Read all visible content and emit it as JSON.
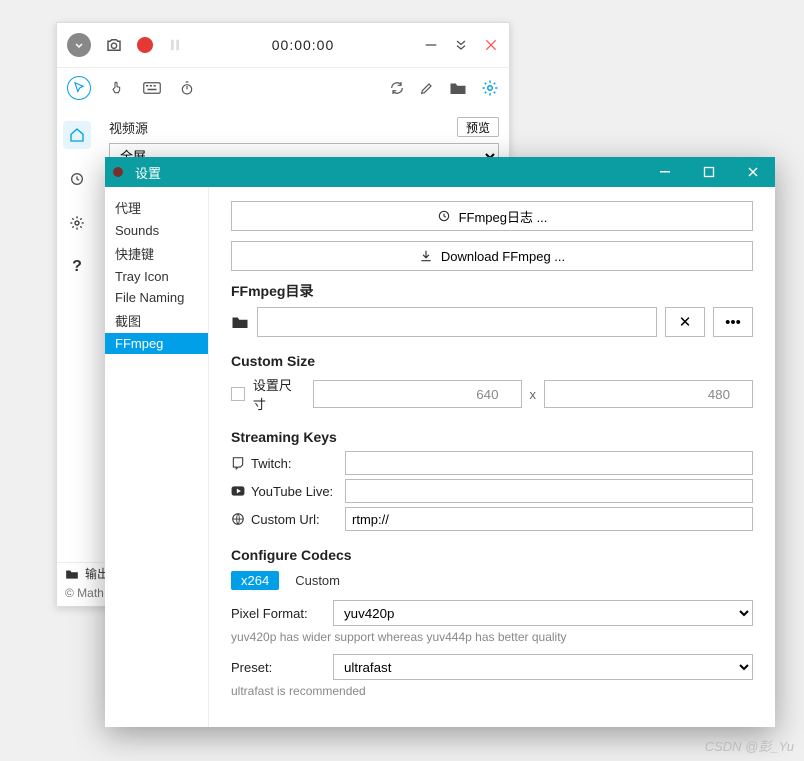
{
  "main": {
    "timer": "00:00:00",
    "video_source_label": "视频源",
    "preview_btn": "预览",
    "source_select_value": "全屏",
    "output_label": "输出",
    "bottom_caption": "© Math"
  },
  "settings": {
    "title": "设置",
    "nav": [
      "代理",
      "Sounds",
      "快捷键",
      "Tray Icon",
      "File Naming",
      "截图",
      "FFmpeg"
    ],
    "nav_active_index": 6,
    "buttons": {
      "log": "FFmpeg日志 ...",
      "download": "Download FFmpeg ..."
    },
    "dir_label": "FFmpeg目录",
    "dir_value": "",
    "dir_clear": "✕",
    "dir_more": "•••",
    "custom_size": {
      "title": "Custom Size",
      "checkbox_label": "设置尺寸",
      "width": "640",
      "height": "480",
      "x": "x"
    },
    "streaming": {
      "title": "Streaming Keys",
      "twitch_label": "Twitch:",
      "youtube_label": "YouTube Live:",
      "custom_label": "Custom Url:",
      "twitch_val": "",
      "youtube_val": "",
      "custom_val": "rtmp://"
    },
    "codecs": {
      "title": "Configure Codecs",
      "tabs": [
        "x264",
        "Custom"
      ],
      "active_tab": 0,
      "pixel_format_label": "Pixel Format:",
      "pixel_format_value": "yuv420p",
      "pixel_hint": "yuv420p has wider support whereas yuv444p has better quality",
      "preset_label": "Preset:",
      "preset_value": "ultrafast",
      "preset_hint": "ultrafast is recommended"
    }
  },
  "watermark": "CSDN @彭_Yu"
}
